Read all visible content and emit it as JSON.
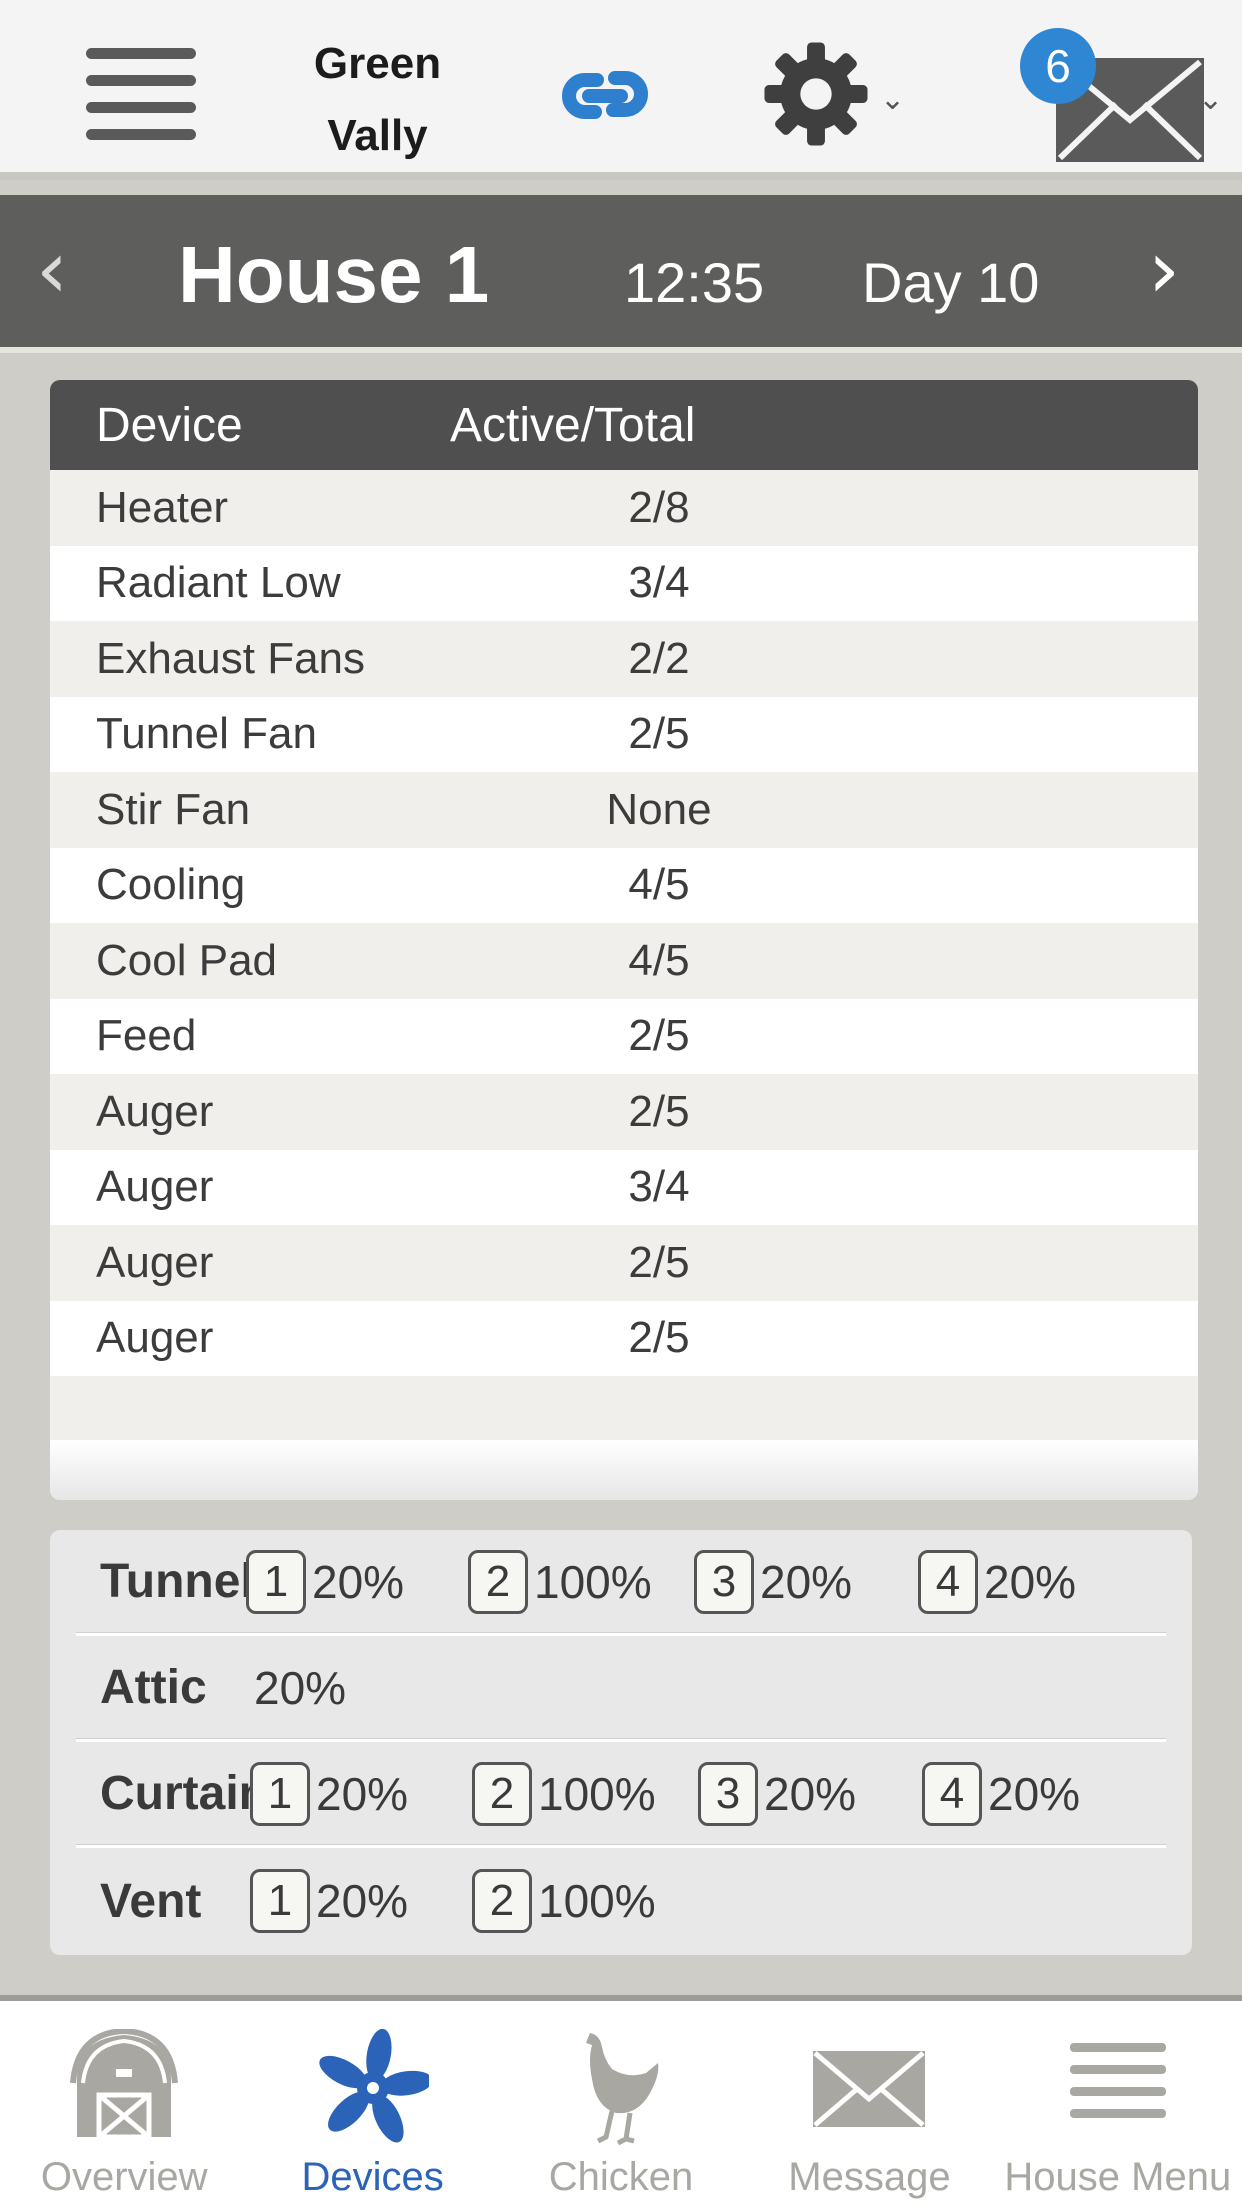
{
  "header": {
    "farm_name_line1": "Green",
    "farm_name_line2": "Vally",
    "mail_badge_count": "6",
    "colors": {
      "accent": "#2f86d3",
      "icon": "#4a4a4a"
    }
  },
  "house_bar": {
    "prev": "‹",
    "next": "›",
    "house_name": "House 1",
    "time": "12:35",
    "day": "Day 10"
  },
  "device_table": {
    "columns": [
      "Device",
      "Active/Total"
    ],
    "rows": [
      {
        "device": "Heater",
        "active_total": "2/8"
      },
      {
        "device": "Radiant Low",
        "active_total": "3/4"
      },
      {
        "device": "Exhaust Fans",
        "active_total": "2/2"
      },
      {
        "device": "Tunnel Fan",
        "active_total": "2/5"
      },
      {
        "device": "Stir Fan",
        "active_total": "None"
      },
      {
        "device": "Cooling",
        "active_total": "4/5"
      },
      {
        "device": "Cool Pad",
        "active_total": "4/5"
      },
      {
        "device": "Feed",
        "active_total": "2/5"
      },
      {
        "device": "Auger",
        "active_total": "2/5"
      },
      {
        "device": "Auger",
        "active_total": "3/4"
      },
      {
        "device": "Auger",
        "active_total": "2/5"
      },
      {
        "device": "Auger",
        "active_total": "2/5"
      }
    ]
  },
  "summary": {
    "rows": [
      {
        "label": "Tunnel",
        "items": [
          {
            "num": "1",
            "value": "20%"
          },
          {
            "num": "2",
            "value": "100%"
          },
          {
            "num": "3",
            "value": "20%"
          },
          {
            "num": "4",
            "value": "20%"
          }
        ]
      },
      {
        "label": "Attic",
        "value": "20%"
      },
      {
        "label": "Curtains",
        "items": [
          {
            "num": "1",
            "value": "20%"
          },
          {
            "num": "2",
            "value": "100%"
          },
          {
            "num": "3",
            "value": "20%"
          },
          {
            "num": "4",
            "value": "20%"
          }
        ]
      },
      {
        "label": "Vent",
        "items": [
          {
            "num": "1",
            "value": "20%"
          },
          {
            "num": "2",
            "value": "100%"
          }
        ]
      }
    ]
  },
  "bottom_nav": {
    "items": [
      {
        "label": "Overview",
        "icon": "barn-icon",
        "active": false
      },
      {
        "label": "Devices",
        "icon": "fan-icon",
        "active": true
      },
      {
        "label": "Chicken",
        "icon": "chicken-icon",
        "active": false
      },
      {
        "label": "Message",
        "icon": "envelope-icon",
        "active": false
      },
      {
        "label": "House Menu",
        "icon": "menu-icon",
        "active": false
      }
    ],
    "active_color": "#2b63b8",
    "inactive_color": "#a9a7a2"
  }
}
